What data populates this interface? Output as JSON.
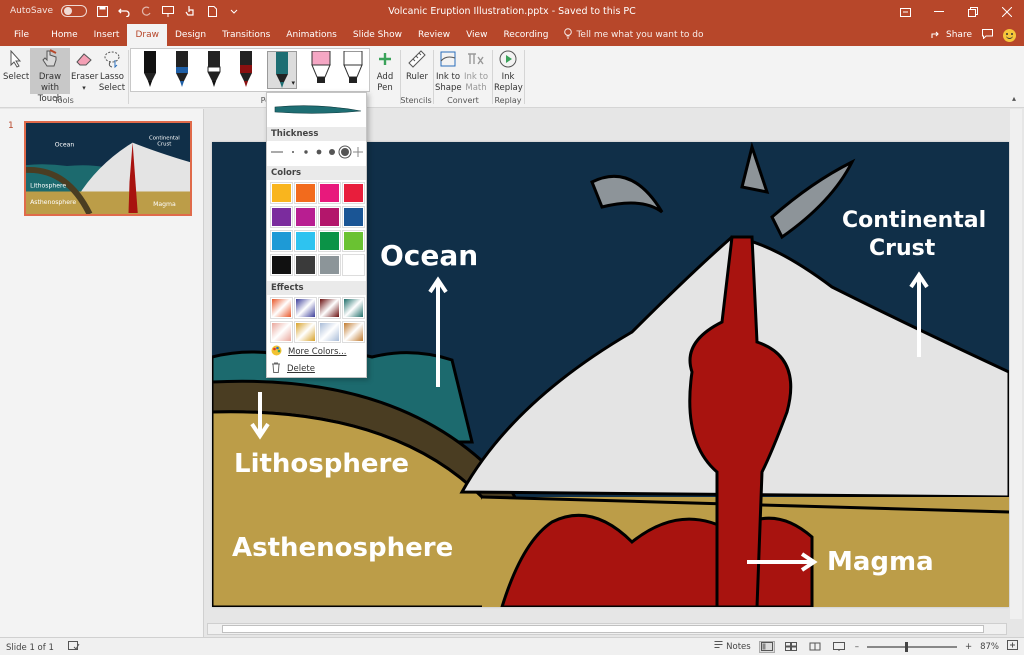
{
  "titlebar": {
    "autosave_label": "AutoSave",
    "autosave_state": "Off",
    "doc_title": "Volcanic Eruption Illustration.pptx  -  Saved to this PC"
  },
  "tabs": [
    "File",
    "Home",
    "Insert",
    "Draw",
    "Design",
    "Transitions",
    "Animations",
    "Slide Show",
    "Review",
    "View",
    "Recording"
  ],
  "active_tab": "Draw",
  "tell_me": "Tell me what you want to do",
  "share_label": "Share",
  "ribbon": {
    "tools": {
      "select": "Select",
      "draw_with_touch_1": "Draw with",
      "draw_with_touch_2": "Touch",
      "eraser": "Eraser",
      "lasso_1": "Lasso",
      "lasso_2": "Select",
      "group": "Tools"
    },
    "pens_group": "Pens",
    "add_pen_1": "Add",
    "add_pen_2": "Pen",
    "ruler": "Ruler",
    "stencils_group": "Stencils",
    "ink_to_shape_1": "Ink to",
    "ink_to_shape_2": "Shape",
    "ink_to_math_1": "Ink to",
    "ink_to_math_2": "Math",
    "convert_group": "Convert",
    "ink_replay_1": "Ink",
    "ink_replay_2": "Replay",
    "replay_group": "Replay"
  },
  "pens": [
    {
      "color": "#111111"
    },
    {
      "color": "#1f5fa6"
    },
    {
      "color": "#111111"
    },
    {
      "color": "#8b1010"
    },
    {
      "color": "#1e6e73",
      "selected": true
    },
    {
      "color": "#f5a7c4"
    },
    {
      "color": "#111111"
    }
  ],
  "dropdown": {
    "thickness_label": "Thickness",
    "colors_label": "Colors",
    "effects_label": "Effects",
    "more_colors": "More Colors...",
    "delete": "Delete",
    "colors": [
      "#f9b51e",
      "#f26b1d",
      "#e8197c",
      "#e81e3c",
      "#7b2c9e",
      "#b81e91",
      "#b3166b",
      "#1a5595",
      "#1e9ad6",
      "#2ec3f0",
      "#0b9347",
      "#6ac232",
      "#111111",
      "#3a3a3a",
      "#8c9599",
      "#ffffff"
    ],
    "effects": [
      "#e8582a",
      "#3d3f9a",
      "#6a0f0f",
      "#1f6e6a",
      "#e9a79c",
      "#d8a22a",
      "#a9bcd8",
      "#c07a2e"
    ]
  },
  "thumbs": {
    "slide_number": "1"
  },
  "slide": {
    "labels": {
      "ocean": "Ocean",
      "continental_1": "Continental",
      "continental_2": "Crust",
      "lithosphere": "Lithosphere",
      "asthenosphere": "Asthenosphere",
      "magma": "Magma"
    },
    "colors": {
      "sky": "#102f48",
      "ocean": "#1c6a6e",
      "crust": "#e4e4e4",
      "asthenosphere": "#bc9d48",
      "lithosphere": "#4a3d22",
      "lava": "#a8130f"
    }
  },
  "status": {
    "slide_of": "Slide 1 of 1",
    "notes": "Notes",
    "zoom": "87%"
  }
}
